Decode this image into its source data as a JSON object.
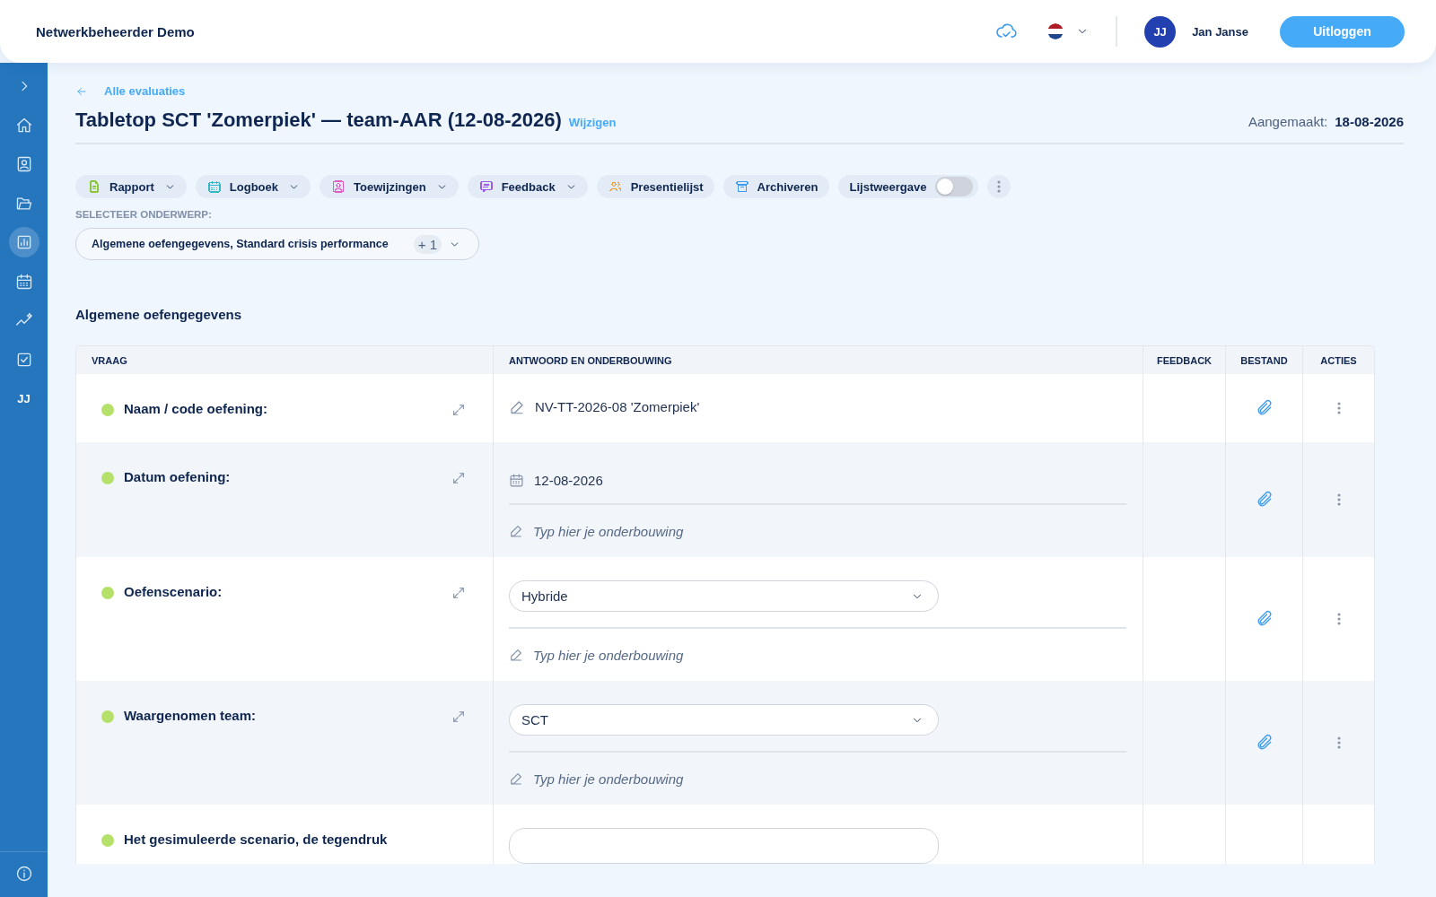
{
  "header": {
    "app_title": "Netwerkbeheerder Demo",
    "avatar_initials": "JJ",
    "user_name": "Jan Janse",
    "logout_button": "Uitloggen"
  },
  "sidebar": {
    "items": [
      {
        "kind": "expand",
        "selected": false
      },
      {
        "kind": "icon",
        "selected": false
      },
      {
        "kind": "icon",
        "selected": false
      },
      {
        "kind": "icon",
        "selected": false
      },
      {
        "kind": "icon",
        "selected": true
      },
      {
        "kind": "icon",
        "selected": false
      },
      {
        "kind": "icon",
        "selected": false
      },
      {
        "kind": "icon",
        "selected": false
      },
      {
        "kind": "initials",
        "label": "JJ",
        "selected": false
      }
    ]
  },
  "page": {
    "breadcrumb": "Alle evaluaties",
    "title": "Tabletop SCT 'Zomerpiek' — team-AAR (12-08-2026)",
    "edit_link": "Wijzigen",
    "created_label": "Aangemaakt:",
    "created_value": "18-08-2026"
  },
  "toolbar": {
    "chips": [
      {
        "label": "Rapport",
        "color": "#8cc63f",
        "dropdown": true
      },
      {
        "label": "Logboek",
        "color": "#36b8c4",
        "dropdown": true
      },
      {
        "label": "Toewijzingen",
        "color": "#e05cc8",
        "dropdown": true
      },
      {
        "label": "Feedback",
        "color": "#9b5de5",
        "dropdown": true
      },
      {
        "label": "Presentielijst",
        "color": "#f0a030",
        "dropdown": false
      },
      {
        "label": "Archiveren",
        "color": "#3d9cf0",
        "dropdown": false
      }
    ],
    "toggle": {
      "label": "Lijstweergave",
      "on": false
    }
  },
  "subject": {
    "label": "SELECTEER ONDERWERP:",
    "value": "Algemene oefengegevens, Standard crisis performance",
    "extra_count": "+ 1"
  },
  "section": {
    "title": "Algemene oefengegevens"
  },
  "table": {
    "columns": [
      "VRAAG",
      "ANTWOORD EN ONDERBOUWING",
      "FEEDBACK",
      "BESTAND",
      "ACTIES"
    ],
    "rows": [
      {
        "question": "Naam / code oefening:",
        "color": "#b5e06a",
        "answer": {
          "kind": "text",
          "value": "NV-TT-2026-08 'Zomerpiek'"
        }
      },
      {
        "question": "Datum oefening:",
        "color": "#b5e06a",
        "answer": {
          "kind": "date",
          "value": "12-08-2026",
          "placeholder": "Typ hier je onderbouwing"
        }
      },
      {
        "question": "Oefenscenario:",
        "color": "#b5e06a",
        "answer": {
          "kind": "select",
          "value": "Hybride",
          "placeholder": "Typ hier je onderbouwing"
        }
      },
      {
        "question": "Waargenomen team:",
        "color": "#b5e06a",
        "answer": {
          "kind": "select",
          "value": "SCT",
          "placeholder": "Typ hier je onderbouwing"
        }
      },
      {
        "question": "Het gesimuleerde scenario, de tegendruk",
        "color": "#b5e06a",
        "answer": {
          "kind": "select"
        }
      }
    ]
  }
}
